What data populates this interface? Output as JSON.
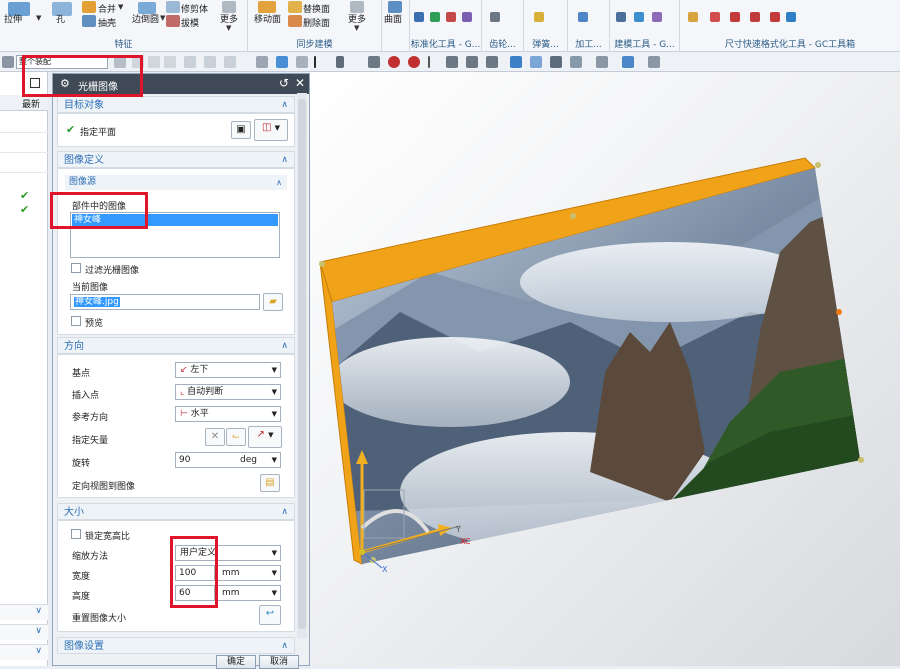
{
  "ribbon": {
    "btn_pull": "拉伸",
    "btn_hole": "孔",
    "btn_unite": "合并",
    "btn_shell": "抽壳",
    "btn_edge_blend": "边倒圆",
    "btn_trim_body": "修剪体",
    "btn_draft": "拔模",
    "btn_more1": "更多",
    "group_feature": "特征",
    "btn_move_face": "移动面",
    "btn_replace_face": "替换面",
    "btn_delete_face": "删除面",
    "btn_more2": "更多",
    "group_sync": "同步建模",
    "btn_surface": "曲面",
    "group_std": "标准化工具 - G...",
    "group_gear": "齿轮...",
    "group_spring": "弹簧...",
    "group_machining": "加工...",
    "group_modeling": "建模工具 - G...",
    "group_dim": "尺寸快速格式化工具 - GC工具箱"
  },
  "toolbar": {
    "assembly_combo": "整个装配"
  },
  "left_pane": {
    "col_latest": "最新"
  },
  "dialog": {
    "title": "光栅图像",
    "sec_target": "目标对象",
    "specify_plane": "指定平面",
    "sec_image_def": "图像定义",
    "sub_image_source": "图像源",
    "images_in_part": "部件中的图像",
    "list_selected": "神女峰",
    "filter_raster": "过滤光栅图像",
    "current_image": "当前图像",
    "current_image_value": "神女峰.jpg",
    "preview": "预览",
    "sec_orientation": "方向",
    "base_point": "基点",
    "base_point_value": "左下",
    "insert_point": "插入点",
    "insert_point_value": "自动判断",
    "ref_direction": "参考方向",
    "ref_direction_value": "水平",
    "specify_vector": "指定矢量",
    "rotation": "旋转",
    "rotation_value": "90",
    "rotation_unit": "deg",
    "orient_view": "定向视图到图像",
    "sec_size": "大小",
    "lock_aspect": "锁定宽高比",
    "scale_method": "缩放方法",
    "scale_method_value": "用户定义",
    "width": "宽度",
    "width_value": "100",
    "width_unit": "mm",
    "height": "高度",
    "height_value": "60",
    "height_unit": "mm",
    "reset_size": "重置图像大小",
    "sec_image_settings": "图像设置",
    "ok": "确定",
    "cancel": "取消"
  },
  "viewport": {
    "axis_y": "Y",
    "axis_xc": "XC",
    "axis_x": "X"
  },
  "colors": {
    "frame_orange": "#f0a318",
    "accent_blue": "#2d6fb5",
    "highlight_red": "#e0142a",
    "select_blue": "#3399ff"
  }
}
